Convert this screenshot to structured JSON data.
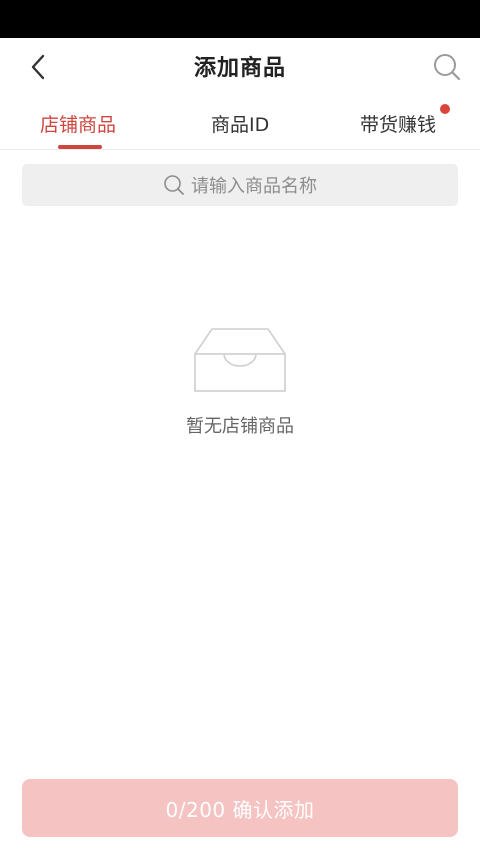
{
  "header": {
    "title": "添加商品"
  },
  "tabs": [
    {
      "label": "店铺商品",
      "active": true
    },
    {
      "label": "商品ID",
      "active": false
    },
    {
      "label": "带货赚钱",
      "active": false,
      "badge": true
    }
  ],
  "search": {
    "placeholder": "请输入商品名称"
  },
  "empty_state": {
    "text": "暂无店铺商品"
  },
  "footer": {
    "confirm_label": "0/200 确认添加"
  },
  "colors": {
    "accent": "#d0463f",
    "confirm_button_disabled": "#f5c3c1",
    "search_bg": "#efefef"
  },
  "icons": [
    "back-arrow-icon",
    "search-icon",
    "empty-box-icon"
  ]
}
